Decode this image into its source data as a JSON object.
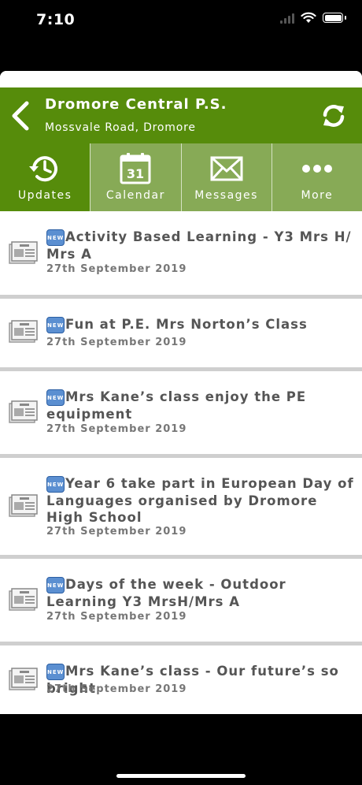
{
  "status_bar": {
    "time": "7:10"
  },
  "header": {
    "school_name": "Dromore Central P.S.",
    "address": "Mossvale Road, Dromore"
  },
  "tabs": [
    {
      "label": "Updates",
      "icon": "clock-refresh-icon",
      "active": true
    },
    {
      "label": "Calendar",
      "icon": "calendar-icon",
      "day": "31",
      "active": false
    },
    {
      "label": "Messages",
      "icon": "envelope-icon",
      "active": false
    },
    {
      "label": "More",
      "icon": "more-dots-icon",
      "active": false
    }
  ],
  "news": [
    {
      "badge": "NEW",
      "title": "Activity Based Learning - Y3 Mrs H/ Mrs A",
      "date": "27th September 2019"
    },
    {
      "badge": "NEW",
      "title": "Fun at P.E. Mrs Norton’s Class",
      "date": "27th September 2019"
    },
    {
      "badge": "NEW",
      "title": "Mrs Kane’s class enjoy the PE equipment",
      "date": "27th September 2019"
    },
    {
      "badge": "NEW",
      "title": "Year 6 take part in European Day of Languages organised by Dromore High School",
      "date": "27th September 2019"
    },
    {
      "badge": "NEW",
      "title": "Days of the week - Outdoor Learning Y3 MrsH/Mrs A",
      "date": "27th September 2019"
    },
    {
      "badge": "NEW",
      "title": "Mrs Kane’s class - Our future’s so bright",
      "date": "27th September 2019"
    }
  ],
  "colors": {
    "header_green": "#568c0b",
    "tab_green": "#87aa56",
    "text_grey": "#555555"
  }
}
